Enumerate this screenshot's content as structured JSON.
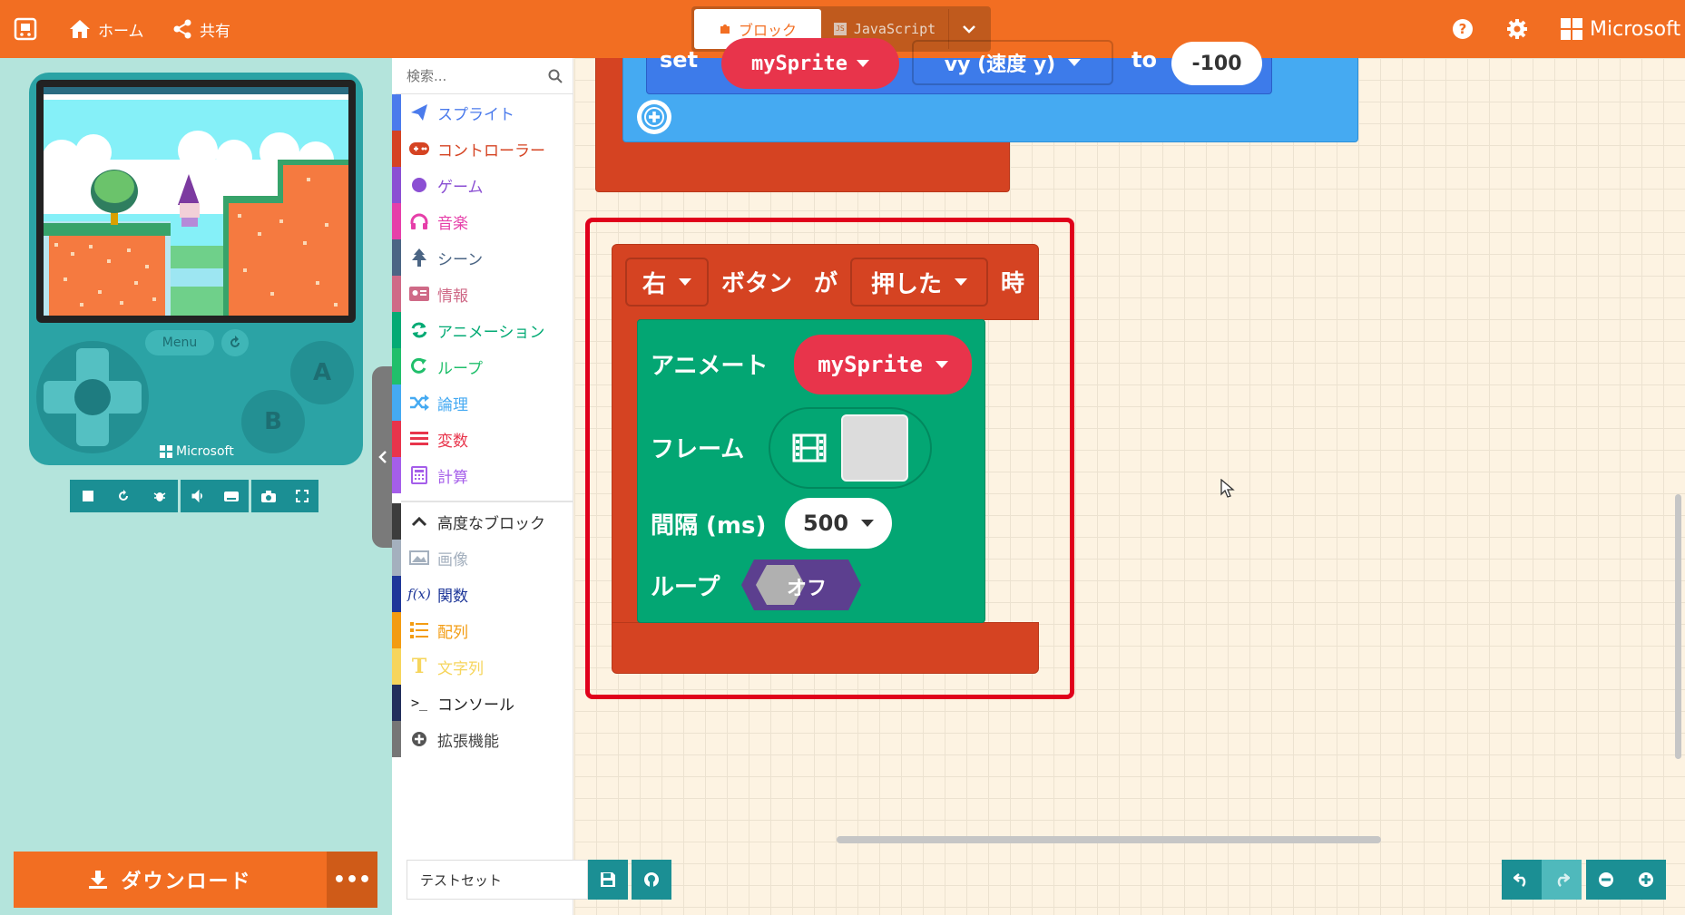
{
  "header": {
    "home_label": "ホーム",
    "share_label": "共有",
    "tab_blocks_label": "ブロック",
    "tab_js_label": "JavaScript",
    "brand_label": "Microsoft"
  },
  "simulator": {
    "menu_label": "Menu",
    "a_label": "A",
    "b_label": "B",
    "brand_label": "Microsoft",
    "download_label": "ダウンロード"
  },
  "toolbox": {
    "search_placeholder": "検索...",
    "categories": [
      {
        "label": "スプライト",
        "color": "#4b7bec",
        "icon": "plane-icon"
      },
      {
        "label": "コントローラー",
        "color": "#d54322",
        "icon": "gamepad-icon"
      },
      {
        "label": "ゲーム",
        "color": "#8b4fd3",
        "icon": "circle-icon"
      },
      {
        "label": "音楽",
        "color": "#e63fa9",
        "icon": "headphones-icon"
      },
      {
        "label": "シーン",
        "color": "#4b6584",
        "icon": "tree-icon"
      },
      {
        "label": "情報",
        "color": "#cf6a87",
        "icon": "id-card-icon"
      },
      {
        "label": "アニメーション",
        "color": "#03aa74",
        "icon": "refresh-icon"
      },
      {
        "label": "ループ",
        "color": "#20bf6b",
        "icon": "loop-icon"
      },
      {
        "label": "論理",
        "color": "#45aaf2",
        "icon": "shuffle-icon"
      },
      {
        "label": "変数",
        "color": "#e8344b",
        "icon": "list-icon"
      },
      {
        "label": "計算",
        "color": "#a55eea",
        "icon": "calculator-icon"
      }
    ],
    "advanced_label": "高度なブロック",
    "advanced": [
      {
        "label": "画像",
        "color": "#a4b0be",
        "icon": "image-icon"
      },
      {
        "label": "関数",
        "color": "#1e3799",
        "icon": "function-icon"
      },
      {
        "label": "配列",
        "color": "#f39c12",
        "icon": "array-icon"
      },
      {
        "label": "文字列",
        "color": "#f6d55c",
        "icon": "text-icon"
      },
      {
        "label": "コンソール",
        "color": "#222f5c",
        "icon": "terminal-icon"
      },
      {
        "label": "拡張機能",
        "color": "#767676",
        "icon": "plus-circle-icon"
      }
    ]
  },
  "workspace": {
    "top_block": {
      "set_label": "set",
      "sprite": "mySprite",
      "prop": "vy (速度 y)",
      "to_label": "to",
      "value": "-100"
    },
    "event_block": {
      "button": "右",
      "label_button": "ボタン",
      "label_ga": "が",
      "action": "押した",
      "label_toki": "時"
    },
    "animate_block": {
      "title": "アニメート",
      "sprite": "mySprite",
      "frames_label": "フレーム",
      "interval_label": "間隔 (ms)",
      "interval_value": "500",
      "loop_label": "ループ",
      "loop_value": "オフ"
    }
  },
  "bottom": {
    "project_name": "テストセット"
  }
}
